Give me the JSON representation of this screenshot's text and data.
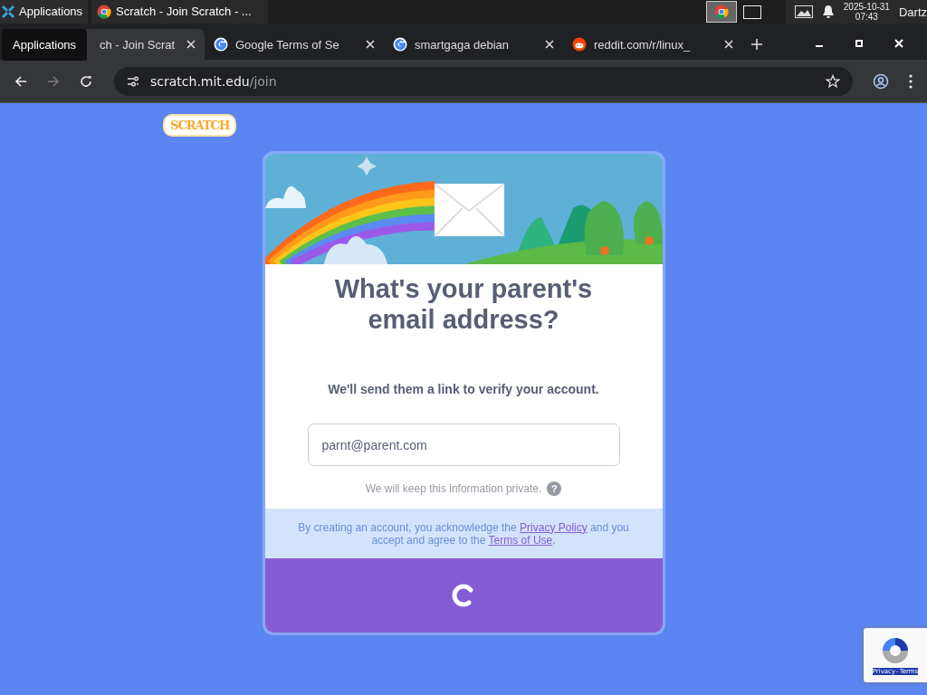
{
  "taskbar": {
    "menu_label": "Applications",
    "task_label": "Scratch - Join Scratch - ...",
    "date": "2025-10-31",
    "time": "07:43",
    "user": "Dartz"
  },
  "tooltip": "Applications",
  "tabs": [
    {
      "label": "ch - Join Scrat",
      "selected": true,
      "kind": "scratch"
    },
    {
      "label": "Google Terms of Se",
      "selected": false,
      "kind": "google"
    },
    {
      "label": "smartgaga debian",
      "selected": false,
      "kind": "google"
    },
    {
      "label": "reddit.com/r/linux_",
      "selected": false,
      "kind": "reddit"
    }
  ],
  "address": {
    "host": "scratch.mit.edu",
    "path": "/join"
  },
  "logo": "SCRATCH",
  "card": {
    "title": "What's your parent's email address?",
    "subtitle": "We'll send them a link to verify your account.",
    "email": {
      "value": "parnt@parent.com"
    },
    "privacy_note": "We will keep this information private.",
    "help": "?",
    "legal": {
      "before": "By creating an account, you acknowledge the",
      "link1": "Privacy Policy",
      "middle": "and you accept and agree to the",
      "link2": "Terms of Use",
      "after": "."
    },
    "loading": true
  },
  "recaptcha": {
    "links": [
      "Privacy",
      "Terms"
    ],
    "separator": "-"
  }
}
